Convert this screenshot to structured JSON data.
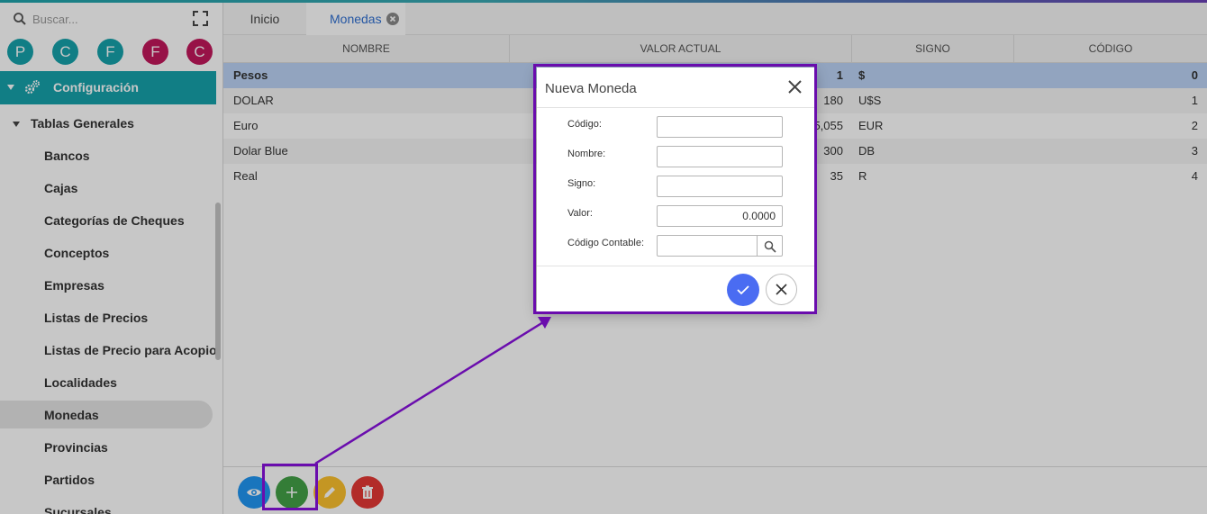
{
  "sidebar": {
    "search_placeholder": "Buscar...",
    "avatars": [
      {
        "letter": "P",
        "color": "#17a2ab"
      },
      {
        "letter": "C",
        "color": "#17a2ab"
      },
      {
        "letter": "F",
        "color": "#17a2ab"
      },
      {
        "letter": "F",
        "color": "#c2185b"
      },
      {
        "letter": "C",
        "color": "#c2185b"
      }
    ],
    "config_label": "Configuración",
    "group_label": "Tablas Generales",
    "items": [
      {
        "label": "Bancos"
      },
      {
        "label": "Cajas"
      },
      {
        "label": "Categorías de Cheques"
      },
      {
        "label": "Conceptos"
      },
      {
        "label": "Empresas"
      },
      {
        "label": "Listas de Precios"
      },
      {
        "label": "Listas de Precio para Acopio"
      },
      {
        "label": "Localidades"
      },
      {
        "label": "Monedas",
        "active": true
      },
      {
        "label": "Provincias"
      },
      {
        "label": "Partidos"
      },
      {
        "label": "Sucursales"
      }
    ]
  },
  "tabs": [
    {
      "label": "Inicio"
    },
    {
      "label": "Monedas",
      "active": true
    }
  ],
  "grid": {
    "columns": [
      "NOMBRE",
      "VALOR ACTUAL",
      "SIGNO",
      "CÓDIGO"
    ],
    "rows": [
      {
        "nombre": "Pesos",
        "valor": "1",
        "signo": "$",
        "codigo": "0"
      },
      {
        "nombre": "DOLAR",
        "valor": "180",
        "signo": "U$S",
        "codigo": "1"
      },
      {
        "nombre": "Euro",
        "valor": "5,055",
        "signo": "EUR",
        "codigo": "2"
      },
      {
        "nombre": "Dolar Blue",
        "valor": "300",
        "signo": "DB",
        "codigo": "3"
      },
      {
        "nombre": "Real",
        "valor": "35",
        "signo": "R",
        "codigo": "4"
      }
    ]
  },
  "footer_buttons": [
    {
      "name": "view",
      "color": "#2196f3"
    },
    {
      "name": "add",
      "color": "#43a047"
    },
    {
      "name": "edit",
      "color": "#fbc02d"
    },
    {
      "name": "delete",
      "color": "#e53935"
    }
  ],
  "dialog": {
    "title": "Nueva Moneda",
    "fields": {
      "codigo_label": "Código:",
      "codigo_value": "",
      "nombre_label": "Nombre:",
      "nombre_value": "",
      "signo_label": "Signo:",
      "signo_value": "",
      "valor_label": "Valor:",
      "valor_value": "0.0000",
      "codigo_contable_label": "Código Contable:",
      "codigo_contable_value": ""
    }
  },
  "colors": {
    "accent": "#17a2ab",
    "selected_row": "#bcd3f5",
    "annotation": "#6a0dad",
    "confirm": "#4a6cf2"
  }
}
